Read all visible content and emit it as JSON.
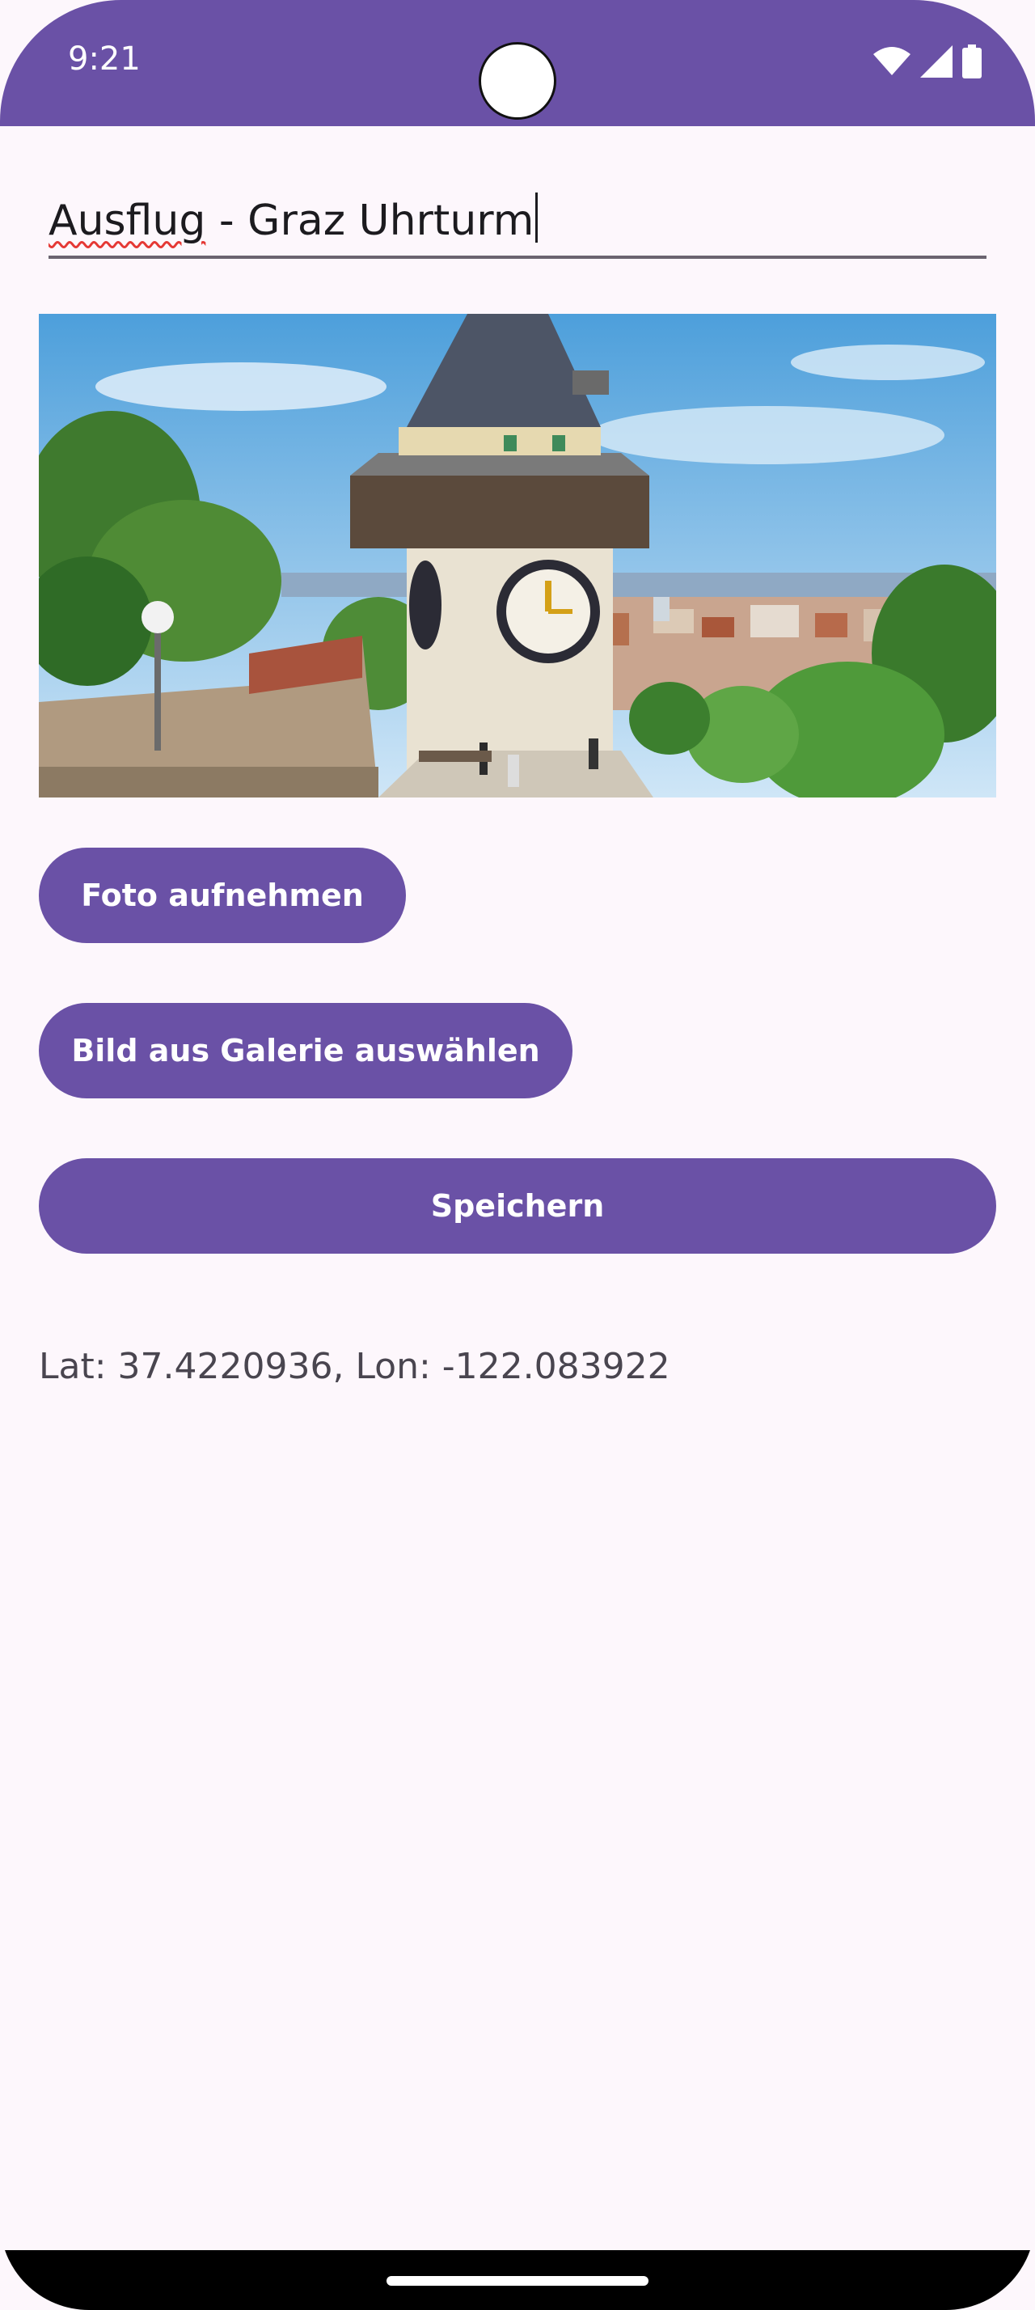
{
  "status_bar": {
    "time": "9:21",
    "icons": [
      "wifi-icon",
      "signal-icon",
      "battery-icon"
    ],
    "color": "#6a51a6"
  },
  "form": {
    "title_underlined": "Ausflug",
    "title_rest": " - Graz Uhrturm"
  },
  "photo": {
    "description_icon": "clock-tower-photo"
  },
  "buttons": {
    "take_photo": "Foto aufnehmen",
    "pick_gallery": "Bild aus Galerie auswählen",
    "save": "Speichern"
  },
  "location": {
    "text": "Lat: 37.4220936, Lon: -122.083922"
  },
  "colors": {
    "accent": "#6a51a6",
    "background": "#fdf7fc",
    "text": "#49454f"
  }
}
